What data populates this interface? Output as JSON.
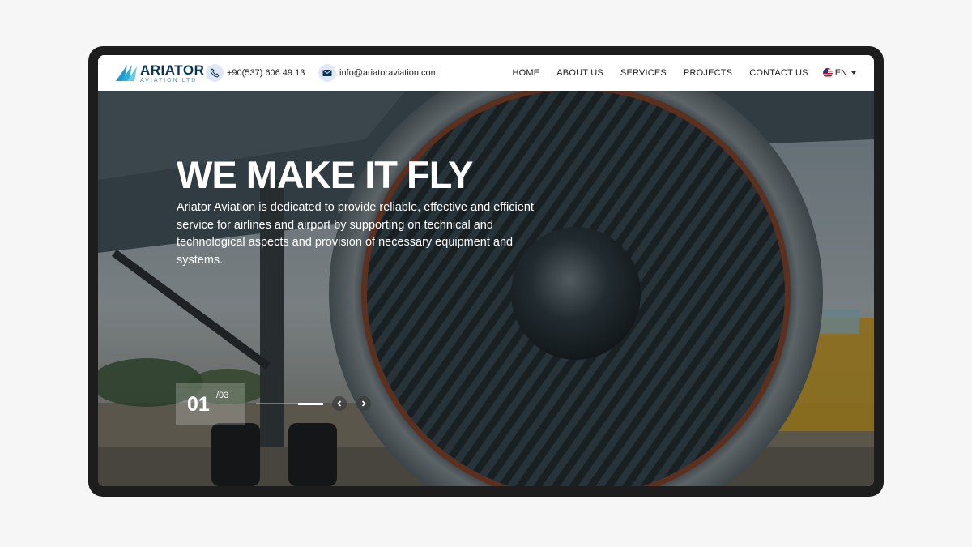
{
  "brand": {
    "name": "ARIATOR",
    "sub": "AVIATION LTD"
  },
  "contact": {
    "phone": "+90(537) 606 49 13",
    "email": "info@ariatoraviation.com"
  },
  "nav": {
    "items": [
      "HOME",
      "ABOUT US",
      "SERVICES",
      "PROJECTS",
      "CONTACT US"
    ],
    "lang": "EN"
  },
  "hero": {
    "title": "WE MAKE IT FLY",
    "description": "Ariator Aviation is dedicated to provide reliable, effective and efficient service for airlines and airport by supporting on technical and technological aspects and provision of necessary equipment and systems.",
    "slide_current": "01",
    "slide_total": "/03",
    "progress": 0.375
  },
  "icons": {
    "phone": "phone-icon",
    "email": "mail-icon",
    "prev": "chevron-left-icon",
    "next": "chevron-right-icon",
    "flag": "us-flag-icon"
  },
  "colors": {
    "brand_dark": "#0b3553",
    "brand_accent": "#1f9bd1",
    "icon_bg": "#dfe8f4"
  }
}
